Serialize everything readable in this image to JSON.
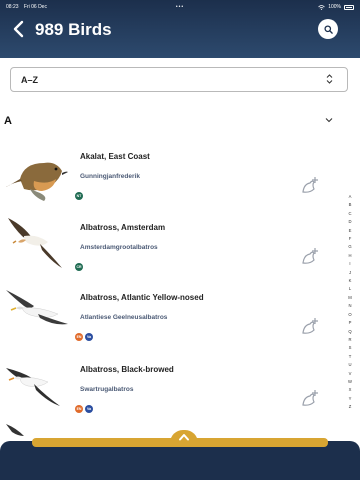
{
  "status": {
    "time": "08:23",
    "date": "Fri 06 Dec",
    "battery": "100%",
    "dots": "•••"
  },
  "header": {
    "title": "989 Birds"
  },
  "sort": {
    "value": "A–Z"
  },
  "section": {
    "letter": "A"
  },
  "species": [
    {
      "name": "Akalat, East Coast",
      "afrikaans": "Gunningjanfrederik",
      "badges": [
        {
          "text": "NT",
          "color": "#1f6b52"
        }
      ]
    },
    {
      "name": "Albatross, Amsterdam",
      "afrikaans": "Amsterdamgrootalbatros",
      "badges": [
        {
          "text": "CR",
          "color": "#1f6b52"
        }
      ]
    },
    {
      "name": "Albatross, Atlantic Yellow-nosed",
      "afrikaans": "Atlantiese Geelneusalbatros",
      "badges": [
        {
          "text": "EN",
          "color": "#e06b2b"
        },
        {
          "text": "Va",
          "color": "#2b4ea0"
        }
      ]
    },
    {
      "name": "Albatross, Black-browed",
      "afrikaans": "Swartrugalbatros",
      "badges": [
        {
          "text": "EN",
          "color": "#e06b2b"
        },
        {
          "text": "Va",
          "color": "#2b4ea0"
        }
      ]
    }
  ],
  "alphabet": [
    "A",
    "B",
    "C",
    "D",
    "E",
    "F",
    "G",
    "H",
    "I",
    "J",
    "K",
    "L",
    "M",
    "N",
    "O",
    "P",
    "Q",
    "R",
    "S",
    "T",
    "U",
    "V",
    "W",
    "X",
    "Y",
    "Z"
  ],
  "colors": {
    "header": "#1c2f4c",
    "accent": "#d8a532",
    "text": "#222222"
  },
  "icons": {
    "back": "chevron-left-icon",
    "search": "search-icon",
    "sort": "chevron-up-down-icon",
    "collapse": "chevron-down-icon",
    "add": "bird-plus-icon",
    "drawer": "chevron-up-icon"
  }
}
